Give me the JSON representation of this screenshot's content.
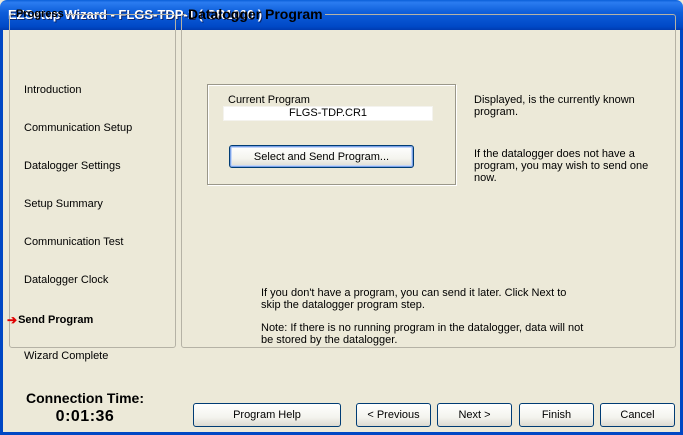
{
  "window": {
    "title": "EZSetup Wizard - FLGS-TDP-1 ( CR1000 )"
  },
  "progress": {
    "legend": "Progress",
    "steps": [
      {
        "label": "Introduction"
      },
      {
        "label": "Communication Setup"
      },
      {
        "label": "Datalogger Settings"
      },
      {
        "label": "Setup Summary"
      },
      {
        "label": "Communication Test"
      },
      {
        "label": "Datalogger Clock"
      },
      {
        "label": "Send Program",
        "current": true
      },
      {
        "label": "Wizard Complete"
      }
    ]
  },
  "connection": {
    "label": "Connection Time:",
    "time": "0:01:36"
  },
  "program": {
    "legend": "Datalogger Program",
    "current_label": "Current Program",
    "current_value": "FLGS-TDP.CR1",
    "select_button": "Select and Send Program...",
    "desc_known_1": "Displayed, is the currently known",
    "desc_known_2": "program.",
    "desc_none_1": "If the datalogger does not have a",
    "desc_none_2": "program, you may wish to send one",
    "desc_none_3": "now.",
    "later_1": "If you don't have a program, you can send it later.  Click Next to",
    "later_2": "skip the datalogger program step.",
    "note_1": "Note: If there is no running program in the datalogger, data will not",
    "note_2": "be stored by the datalogger."
  },
  "buttons": {
    "help": "Program Help",
    "previous": "< Previous",
    "next": "Next >",
    "finish": "Finish",
    "cancel": "Cancel"
  },
  "icons": {
    "current_step": "arrow-right-icon"
  },
  "colors": {
    "titlebar": "#0a5fd8",
    "current_arrow": "#e00000",
    "face": "#ece9d8"
  }
}
